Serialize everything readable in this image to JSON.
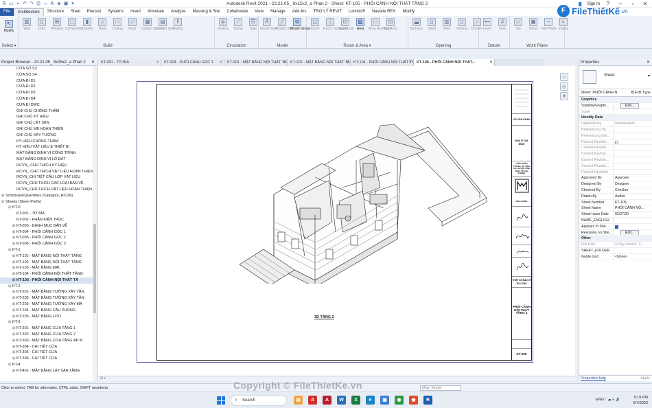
{
  "window": {
    "title": "Autodesk Revit 2021 - 23.21.05_ 9x15x2_a Phan 2 - Sheet: KT-105 - PHỐI CẢNH NỘI THẤT TẦNG 2",
    "sign_in": "Sign In"
  },
  "ribbon_tabs": [
    "File",
    "Architecture",
    "Structure",
    "Steel",
    "Precast",
    "Systems",
    "Insert",
    "Annotate",
    "Analyze",
    "Massing & Site",
    "Collaborate",
    "View",
    "Manage",
    "Add-Ins",
    "TRỢ LÝ REVIT",
    "Lumion®",
    "Naviate REX",
    "Modify"
  ],
  "ribbon": {
    "modify": "Modify",
    "select": "Select ▾",
    "groups": {
      "build": "Build",
      "circulation": "Circulation",
      "model": "Model",
      "room_area": "Room & Area ▾",
      "opening": "Opening",
      "datum": "Datum",
      "work_plane": "Work Plane"
    },
    "buttons": [
      "Wall",
      "Door",
      "Window",
      "Component",
      "Column",
      "Roof",
      "Ceiling",
      "Floor",
      "Curtain System",
      "Curtain Grid",
      "Mullion",
      "Railing",
      "Ramp",
      "Stair",
      "Model Text",
      "Model Line",
      "Model Group",
      "Room",
      "Room Separator",
      "Tag Room",
      "Area",
      "Area Boundary",
      "Tag Area",
      "By Face",
      "Shaft",
      "Wall",
      "Vertical",
      "Dormer",
      "Level",
      "Grid",
      "Set",
      "Show",
      "Ref Plane",
      "Viewer"
    ]
  },
  "logo": {
    "text": "FileThiếtKế",
    "suffix": ".vn",
    "badge": "F"
  },
  "project_browser": {
    "title": "Project Browser - 23.21.05_ 9x15x2_a Phan 2",
    "items": [
      {
        "label": "CỬA SỔ S3",
        "level": 3,
        "exp": ""
      },
      {
        "label": "CỬA SỔ S4",
        "level": 3,
        "exp": ""
      },
      {
        "label": "CỬA ĐI D1",
        "level": 3,
        "exp": ""
      },
      {
        "label": "CỬA ĐI D2",
        "level": 3,
        "exp": ""
      },
      {
        "label": "CỬA ĐI D3",
        "level": 3,
        "exp": ""
      },
      {
        "label": "CỬA ĐI D4",
        "level": 3,
        "exp": ""
      },
      {
        "label": "CỬA ĐI DWC",
        "level": 3,
        "exp": ""
      },
      {
        "label": "GHI CHÚ CHỐNG THẤM",
        "level": 3,
        "exp": ""
      },
      {
        "label": "GHI CHÚ KÝ HIỆU",
        "level": 3,
        "exp": ""
      },
      {
        "label": "GHI CHÚ LÁT SÀN",
        "level": 3,
        "exp": ""
      },
      {
        "label": "GHI CHÚ MB HOÀN THIỆN",
        "level": 3,
        "exp": ""
      },
      {
        "label": "GHI CHÚ XÂY TƯỜNG",
        "level": 3,
        "exp": ""
      },
      {
        "label": "KÝ HIỆU CHỐNG THẤM",
        "level": 3,
        "exp": ""
      },
      {
        "label": "KÝ HIỆU VẬT LIỆU & THIẾT BỊ",
        "level": 3,
        "exp": ""
      },
      {
        "label": "MẶT BẰNG ĐỊNH VỊ CÔNG TRÌNH",
        "level": 3,
        "exp": ""
      },
      {
        "label": "MẶT BẰNG ĐỊNH VỊ LÔ ĐẤT",
        "level": 3,
        "exp": ""
      },
      {
        "label": "RCVN_ CHÚ THÍCH KÝ HIỆU",
        "level": 3,
        "exp": ""
      },
      {
        "label": "RCVN_ CHÚ THÍCH VẬT LIỆU HOÀN THIỆN",
        "level": 3,
        "exp": ""
      },
      {
        "label": "RCVN_CHI TIẾT CẤU LỚP VẬT LIỆU",
        "level": 3,
        "exp": ""
      },
      {
        "label": "RCVN_CHÚ THÍCH CÁC LOẠI BẢN VẼ",
        "level": 3,
        "exp": ""
      },
      {
        "label": "RCVN_CHÚ THÍCH VẬT LIỆU HOÀN THIỆN",
        "level": 3,
        "exp": ""
      },
      {
        "label": "Schedules/Quantities (Category_RCVN)",
        "level": 1,
        "exp": "⊞"
      },
      {
        "label": "Sheets (Sheet Prefix)",
        "level": 1,
        "exp": "⊟"
      },
      {
        "label": "KT-0",
        "level": 2,
        "exp": "⊟"
      },
      {
        "label": "KT-001 - TỜ BÌA",
        "level": 3,
        "exp": ""
      },
      {
        "label": "KT-002 - PHẦN KIẾN TRÚC",
        "level": 3,
        "exp": ""
      },
      {
        "label": "KT-003 - DANH MỤC BẢN VẼ",
        "level": 3,
        "exp": "⊞"
      },
      {
        "label": "KT-004 - PHỐI CẢNH GÓC 1",
        "level": 3,
        "exp": "⊞"
      },
      {
        "label": "KT-005 - PHỐI CẢNH GÓC 2",
        "level": 3,
        "exp": "⊞"
      },
      {
        "label": "KT-006 - PHỐI CẢNH GÓC 3",
        "level": 3,
        "exp": "⊞"
      },
      {
        "label": "KT-1",
        "level": 2,
        "exp": "⊟"
      },
      {
        "label": "KT-101 - MẶT BẰNG NỘI THẤT TẦNG",
        "level": 3,
        "exp": "⊞"
      },
      {
        "label": "KT-102 - MẶT BẰNG NỘI THẤT TẦNG",
        "level": 3,
        "exp": "⊞"
      },
      {
        "label": "KT-103 - MẶT BẰNG MÁI",
        "level": 3,
        "exp": "⊞"
      },
      {
        "label": "KT-104 - PHỐI CẢNH NỘI THẤT TẦNG",
        "level": 3,
        "exp": "⊞"
      },
      {
        "label": "KT-105 - PHỐI CẢNH NỘI THẤT TẦ",
        "level": 3,
        "exp": "⊞",
        "selected": true
      },
      {
        "label": "KT-2",
        "level": 2,
        "exp": "⊟"
      },
      {
        "label": "KT-201 - MẶT BẰNG TƯỜNG XÂY TẦN",
        "level": 3,
        "exp": "⊞"
      },
      {
        "label": "KT-202 - MẶT BẰNG TƯỜNG XÂY TẦN",
        "level": 3,
        "exp": "⊞"
      },
      {
        "label": "KT-203 - MẶT BẰNG TƯỜNG XÂY MÁ",
        "level": 3,
        "exp": "⊞"
      },
      {
        "label": "KT-204 - MẶT BẰNG CẦU PHONG",
        "level": 3,
        "exp": "⊞"
      },
      {
        "label": "KT-205 - MẶT BẰNG LITO",
        "level": 3,
        "exp": "⊞"
      },
      {
        "label": "KT-3",
        "level": 2,
        "exp": "⊟"
      },
      {
        "label": "KT-301 - MẶT BẰNG CỬA TẦNG 1",
        "level": 3,
        "exp": "⊞"
      },
      {
        "label": "KT-302 - MẶT BẰNG CỬA TẦNG 2",
        "level": 3,
        "exp": "⊞"
      },
      {
        "label": "KT-303 - MẶT BẰNG CỬA TẦNG ÁP M",
        "level": 3,
        "exp": "⊞"
      },
      {
        "label": "KT-304 - CHI TIẾT CỬA",
        "level": 3,
        "exp": "⊞"
      },
      {
        "label": "KT-305 - CHI TIẾT CỬA",
        "level": 3,
        "exp": "⊞"
      },
      {
        "label": "KT-306 - CHI TIẾT CỬA",
        "level": 3,
        "exp": "⊞"
      },
      {
        "label": "KT-4",
        "level": 2,
        "exp": "⊟"
      },
      {
        "label": "KT-401 - MẶT BẰNG LÁT SÀN TẦNG",
        "level": 3,
        "exp": "⊞"
      }
    ]
  },
  "view_tabs": [
    {
      "label": "KT-001 - TỜ BÌA",
      "active": false
    },
    {
      "label": "KT-004 - PHỐI CẢNH GÓC 1",
      "active": false
    },
    {
      "label": "KT-101 - MẶT BẰNG NỘI THẤT TẦ...",
      "active": false
    },
    {
      "label": "KT-102 - MẶT BẰNG NỘI THẤT TẦ...",
      "active": false
    },
    {
      "label": "KT-104 - PHỐI CẢNH NỘI THẤT TẦ...",
      "active": false
    },
    {
      "label": "KT-105 - PHỐI CẢNH NỘI THẤT...",
      "active": true
    }
  ],
  "sheet": {
    "view_title": "3D TẦNG 2",
    "tb_owner": "VÕ VĂN PHAN",
    "tb_project": "NHÀ Ở GIA ĐÌNH",
    "tb_location": "THÔN THIẾT TRANH- XÃ VĨNH AN- HUYỆN VĨNH BẢO- TP. HẢI PHÒNG",
    "tb_brand": "MAD HOME",
    "tb_design": "THIẾT KẾ BẢN VẼ THI CÔNG",
    "tb_drawing_title": "PHỐI CẢNH NỘI THẤT TẦNG 2",
    "tb_sheet_no": "KT-105"
  },
  "properties": {
    "title": "Properties",
    "type": "Sheet",
    "filter": "Sheet: PHỐI CẢNH N",
    "edit_type": "Edit Type",
    "rows": [
      {
        "cat": "Graphics"
      },
      {
        "k": "Visibility/Graphi...",
        "v": "Edit...",
        "btn": true
      },
      {
        "k": "Scale",
        "v": "",
        "dim": true
      },
      {
        "cat": "Identity Data"
      },
      {
        "k": "Dependency",
        "v": "Independent",
        "dim": true
      },
      {
        "k": "Referencing Sh...",
        "v": "",
        "dim": true
      },
      {
        "k": "Referencing Det...",
        "v": "",
        "dim": true
      },
      {
        "k": "Current Revisio...",
        "v": "",
        "dim": true,
        "chk": "off"
      },
      {
        "k": "Current Revisio...",
        "v": "",
        "dim": true
      },
      {
        "k": "Current Revisio...",
        "v": "",
        "dim": true
      },
      {
        "k": "Current Revisio...",
        "v": "",
        "dim": true
      },
      {
        "k": "Current Revisio...",
        "v": "",
        "dim": true
      },
      {
        "k": "Current Revision",
        "v": "",
        "dim": true
      },
      {
        "k": "Approved By",
        "v": "Approver"
      },
      {
        "k": "Designed By",
        "v": "Designer"
      },
      {
        "k": "Checked By",
        "v": "Checker"
      },
      {
        "k": "Drawn By",
        "v": "Author"
      },
      {
        "k": "Sheet Number",
        "v": "KT-105"
      },
      {
        "k": "Sheet Name",
        "v": "PHỐI CẢNH NỘ..."
      },
      {
        "k": "Sheet Issue Date",
        "v": "02/27/20"
      },
      {
        "k": "NAME_ENGLISH",
        "v": ""
      },
      {
        "k": "Appears In She...",
        "v": "",
        "chk": "on"
      },
      {
        "k": "Revisions on She...",
        "v": "Edit...",
        "btn": true
      },
      {
        "cat": "Other"
      },
      {
        "k": "File Path",
        "v": "G:\\My Drive\\2. C...",
        "dim": true
      },
      {
        "k": "SHEET_FOLDER",
        "v": ""
      },
      {
        "k": "Guide Grid",
        "v": "<None>"
      }
    ],
    "help": "Properties help",
    "apply": "Apply"
  },
  "status": {
    "text": "Click to select, TAB for alternates, CTRL adds, SHIFT unselects.",
    "model": "Main Model"
  },
  "taskbar": {
    "search": "Search",
    "lang": "ENG",
    "time": "5:19 PM",
    "date": "6/7/2023"
  },
  "watermark": "Copyright © FileThietKe.vn"
}
